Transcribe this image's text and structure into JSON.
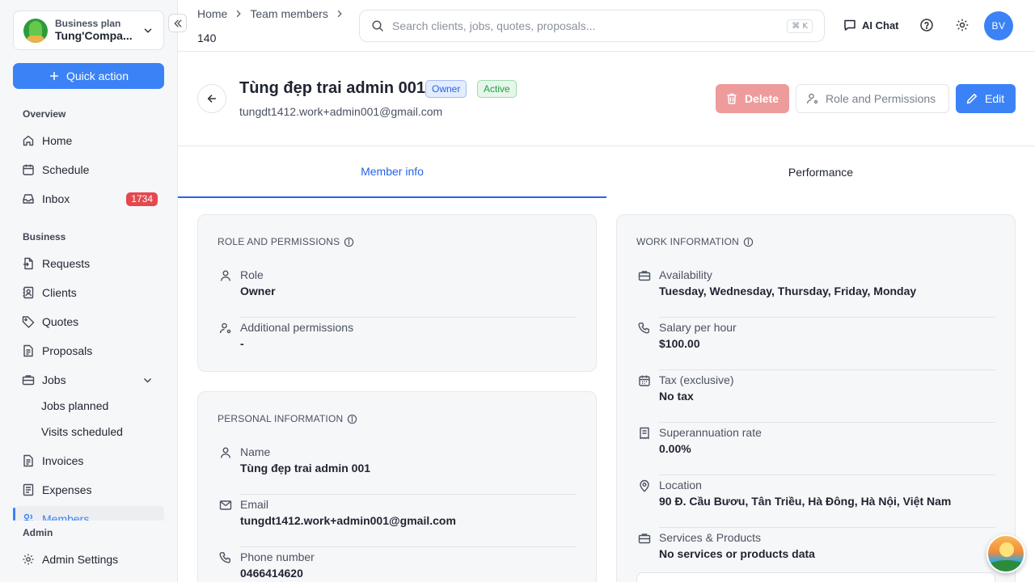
{
  "company": {
    "plan": "Business plan",
    "name": "Tung'Compa..."
  },
  "quick_action": "Quick action",
  "sidebar": {
    "overview_label": "Overview",
    "business_label": "Business",
    "admin_label": "Admin",
    "items": {
      "home": "Home",
      "schedule": "Schedule",
      "inbox": "Inbox",
      "inbox_count": "1734",
      "requests": "Requests",
      "clients": "Clients",
      "quotes": "Quotes",
      "proposals": "Proposals",
      "jobs": "Jobs",
      "jobs_planned": "Jobs planned",
      "visits_scheduled": "Visits scheduled",
      "invoices": "Invoices",
      "expenses": "Expenses",
      "members": "Members",
      "admin_settings": "Admin Settings"
    }
  },
  "topbar": {
    "breadcrumb": [
      "Home",
      "Team members"
    ],
    "breadcrumb_sub": "140",
    "search_placeholder": "Search clients, jobs, quotes, proposals...",
    "search_shortcut": "⌘ K",
    "ai_chat": "AI Chat",
    "avatar_initials": "BV"
  },
  "member": {
    "name": "Tùng đẹp trai admin 001",
    "role_tag": "Owner",
    "status_tag": "Active",
    "email": "tungdt1412.work+admin001@gmail.com"
  },
  "actions": {
    "delete": "Delete",
    "role_permissions": "Role and Permissions",
    "edit": "Edit"
  },
  "tabs": {
    "member_info": "Member info",
    "performance": "Performance"
  },
  "role_card": {
    "title": "ROLE AND PERMISSIONS",
    "role_label": "Role",
    "role_value": "Owner",
    "perm_label": "Additional permissions",
    "perm_value": "-"
  },
  "personal_card": {
    "title": "PERSONAL INFORMATION",
    "name_label": "Name",
    "name_value": "Tùng đẹp trai admin 001",
    "email_label": "Email",
    "email_value": "tungdt1412.work+admin001@gmail.com",
    "phone_label": "Phone number",
    "phone_value": "0466414620"
  },
  "work_card": {
    "title": "WORK INFORMATION",
    "availability_label": "Availability",
    "availability_value": "Tuesday, Wednesday, Thursday, Friday, Monday",
    "salary_label": "Salary per hour",
    "salary_value": "$100.00",
    "tax_label": "Tax (exclusive)",
    "tax_value": "No tax",
    "super_label": "Superannuation rate",
    "super_value": "0.00%",
    "location_label": "Location",
    "location_value": "90 Đ. Cầu Bươu, Tân Triều, Hà Đông, Hà Nội, Việt Nam",
    "services_label": "Services & Products",
    "services_value": "No services or products data"
  },
  "colors": {
    "accent": "#3b82f6",
    "danger_bg": "#ee9b9b",
    "badge": "#e5484d",
    "active_green": "#1e9e45"
  }
}
